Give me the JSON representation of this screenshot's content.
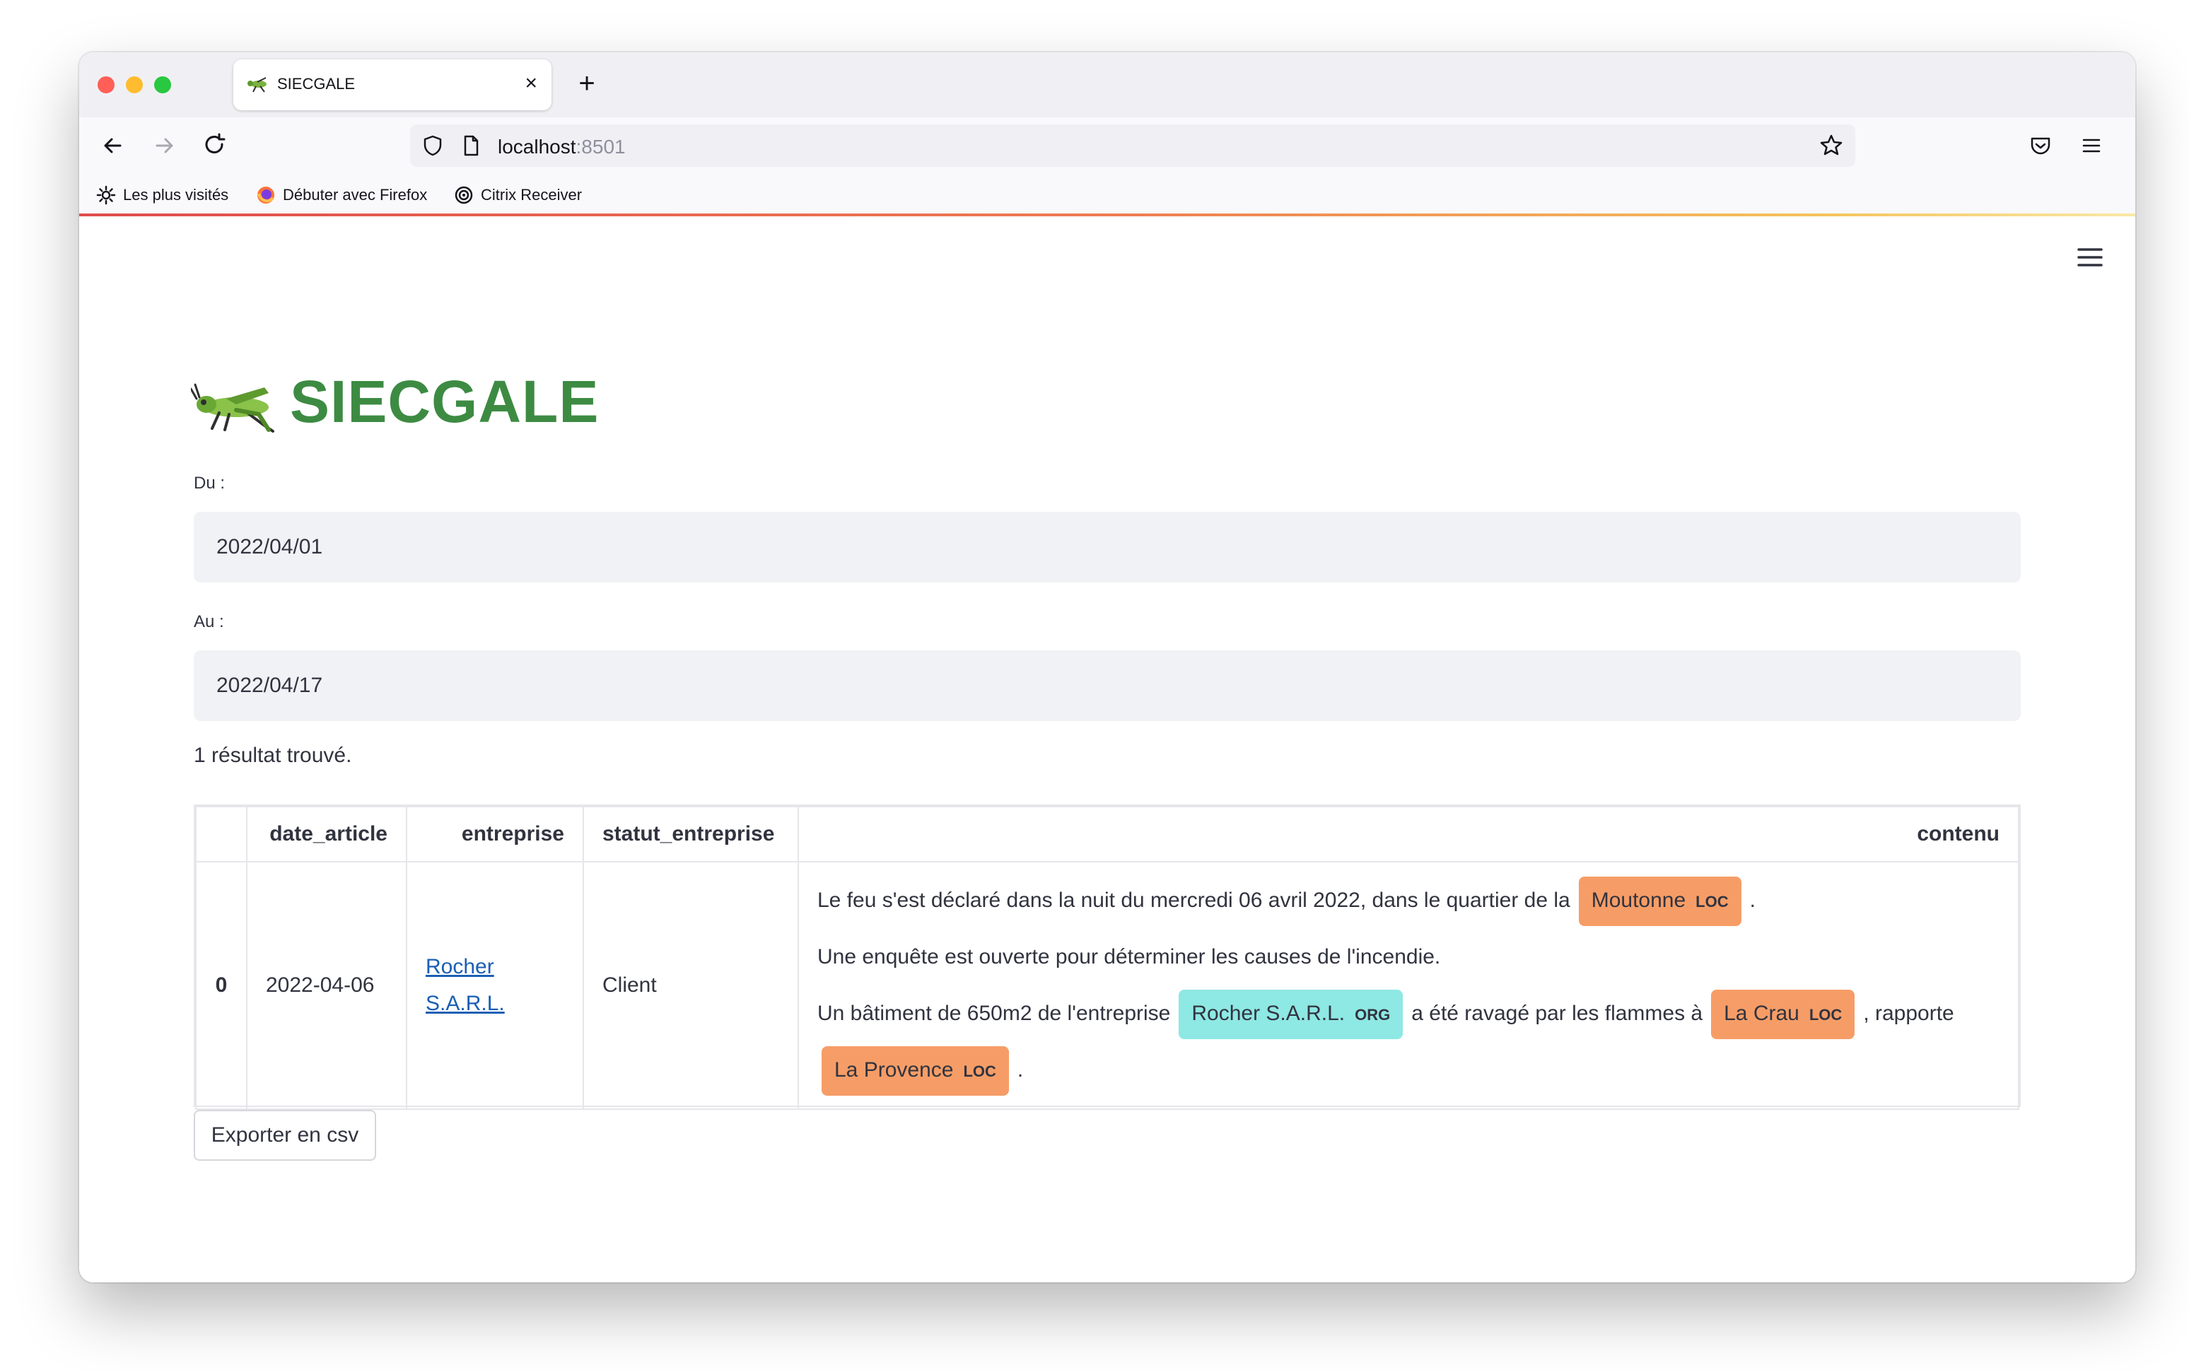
{
  "browser": {
    "tab_title": "SIECGALE",
    "tab_close": "×",
    "new_tab": "+",
    "url_host": "localhost",
    "url_port": ":8501",
    "bookmarks": [
      "Les plus visités",
      "Débuter avec Firefox",
      "Citrix Receiver"
    ]
  },
  "app": {
    "title": "SIECGALE",
    "from_label": "Du :",
    "from_value": "2022/04/01",
    "to_label": "Au :",
    "to_value": "2022/04/17",
    "result_count": "1 résultat trouvé.",
    "export_label": "Exporter en csv"
  },
  "table": {
    "columns": [
      "",
      "date_article",
      "entreprise",
      "statut_entreprise",
      "contenu"
    ],
    "rows": [
      {
        "index": "0",
        "date_article": "2022-04-06",
        "entreprise_line1": "Rocher",
        "entreprise_line2": "S.A.R.L.",
        "statut_entreprise": "Client",
        "contenu": {
          "l1_text": "Le feu s'est déclaré dans la nuit du mercredi 06 avril 2022, dans le quartier de la",
          "l1_ent": "Moutonne",
          "l1_ent_label": "LOC",
          "l1_end": ".",
          "l2_text": "Une enquête est ouverte pour déterminer les causes de l'incendie.",
          "l3_text": "Un bâtiment de 650m2 de l'entreprise",
          "l3_ent1": "Rocher S.A.R.L.",
          "l3_ent1_label": "ORG",
          "l3_mid": "a été ravagé par les flammes à",
          "l3_ent2": "La Crau",
          "l3_ent2_label": "LOC",
          "l3_end": ", rapporte",
          "l4_ent": "La Provence",
          "l4_ent_label": "LOC",
          "l4_end": "."
        }
      }
    ]
  },
  "colors": {
    "title": "#3d8b43",
    "loc_entity": "#f69d67",
    "org_entity": "#8ee8e3",
    "link": "#1a5fb4"
  }
}
